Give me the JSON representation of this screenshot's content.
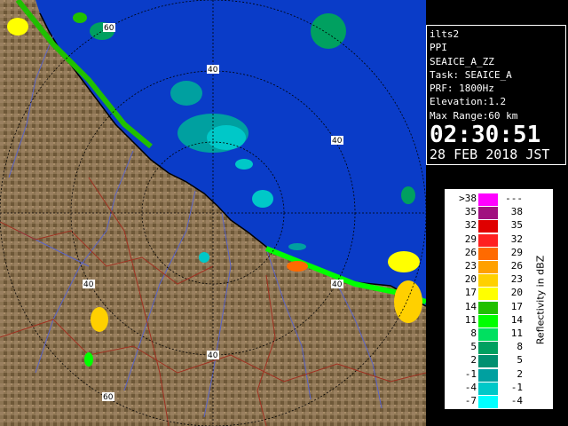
{
  "info": {
    "site": "ilts2",
    "product": "PPI",
    "scan_name": "SEAICE_A_ZZ",
    "task": "Task: SEAICE_A",
    "prf": "PRF: 1800Hz",
    "elevation": "Elevation:1.2",
    "max_range": "Max Range:60 km",
    "time": "02:30:51",
    "date": "28 FEB 2018 JST"
  },
  "legend": {
    "title": "Reflectivity in dBZ",
    "rows": [
      {
        "lo": ">38",
        "hi": "---",
        "color": "#ff00ff"
      },
      {
        "lo": "35",
        "hi": "38",
        "color": "#a01080"
      },
      {
        "lo": "32",
        "hi": "35",
        "color": "#e00000"
      },
      {
        "lo": "29",
        "hi": "32",
        "color": "#ff2020"
      },
      {
        "lo": "26",
        "hi": "29",
        "color": "#ff6a00"
      },
      {
        "lo": "23",
        "hi": "26",
        "color": "#ffa000"
      },
      {
        "lo": "20",
        "hi": "23",
        "color": "#ffd000"
      },
      {
        "lo": "17",
        "hi": "20",
        "color": "#ffff00"
      },
      {
        "lo": "14",
        "hi": "17",
        "color": "#20c000"
      },
      {
        "lo": "11",
        "hi": "14",
        "color": "#00ff00"
      },
      {
        "lo": "8",
        "hi": "11",
        "color": "#00e060"
      },
      {
        "lo": "5",
        "hi": "8",
        "color": "#00a060"
      },
      {
        "lo": "2",
        "hi": "5",
        "color": "#009070"
      },
      {
        "lo": "-1",
        "hi": "2",
        "color": "#00a0a0"
      },
      {
        "lo": "-4",
        "hi": "-1",
        "color": "#00c8c8"
      },
      {
        "lo": "-7",
        "hi": "-4",
        "color": "#00ffff"
      }
    ]
  },
  "map": {
    "ring_labels": [
      "60",
      "40",
      "40",
      "40",
      "40",
      "40",
      "60"
    ],
    "colors": {
      "sea": "#0a3cc8",
      "land": "#8a7250",
      "land_dark": "#5e4a30",
      "river": "#5a64c8",
      "boundary": "#a03020",
      "coast": "#000000",
      "rings": "#000000"
    }
  }
}
